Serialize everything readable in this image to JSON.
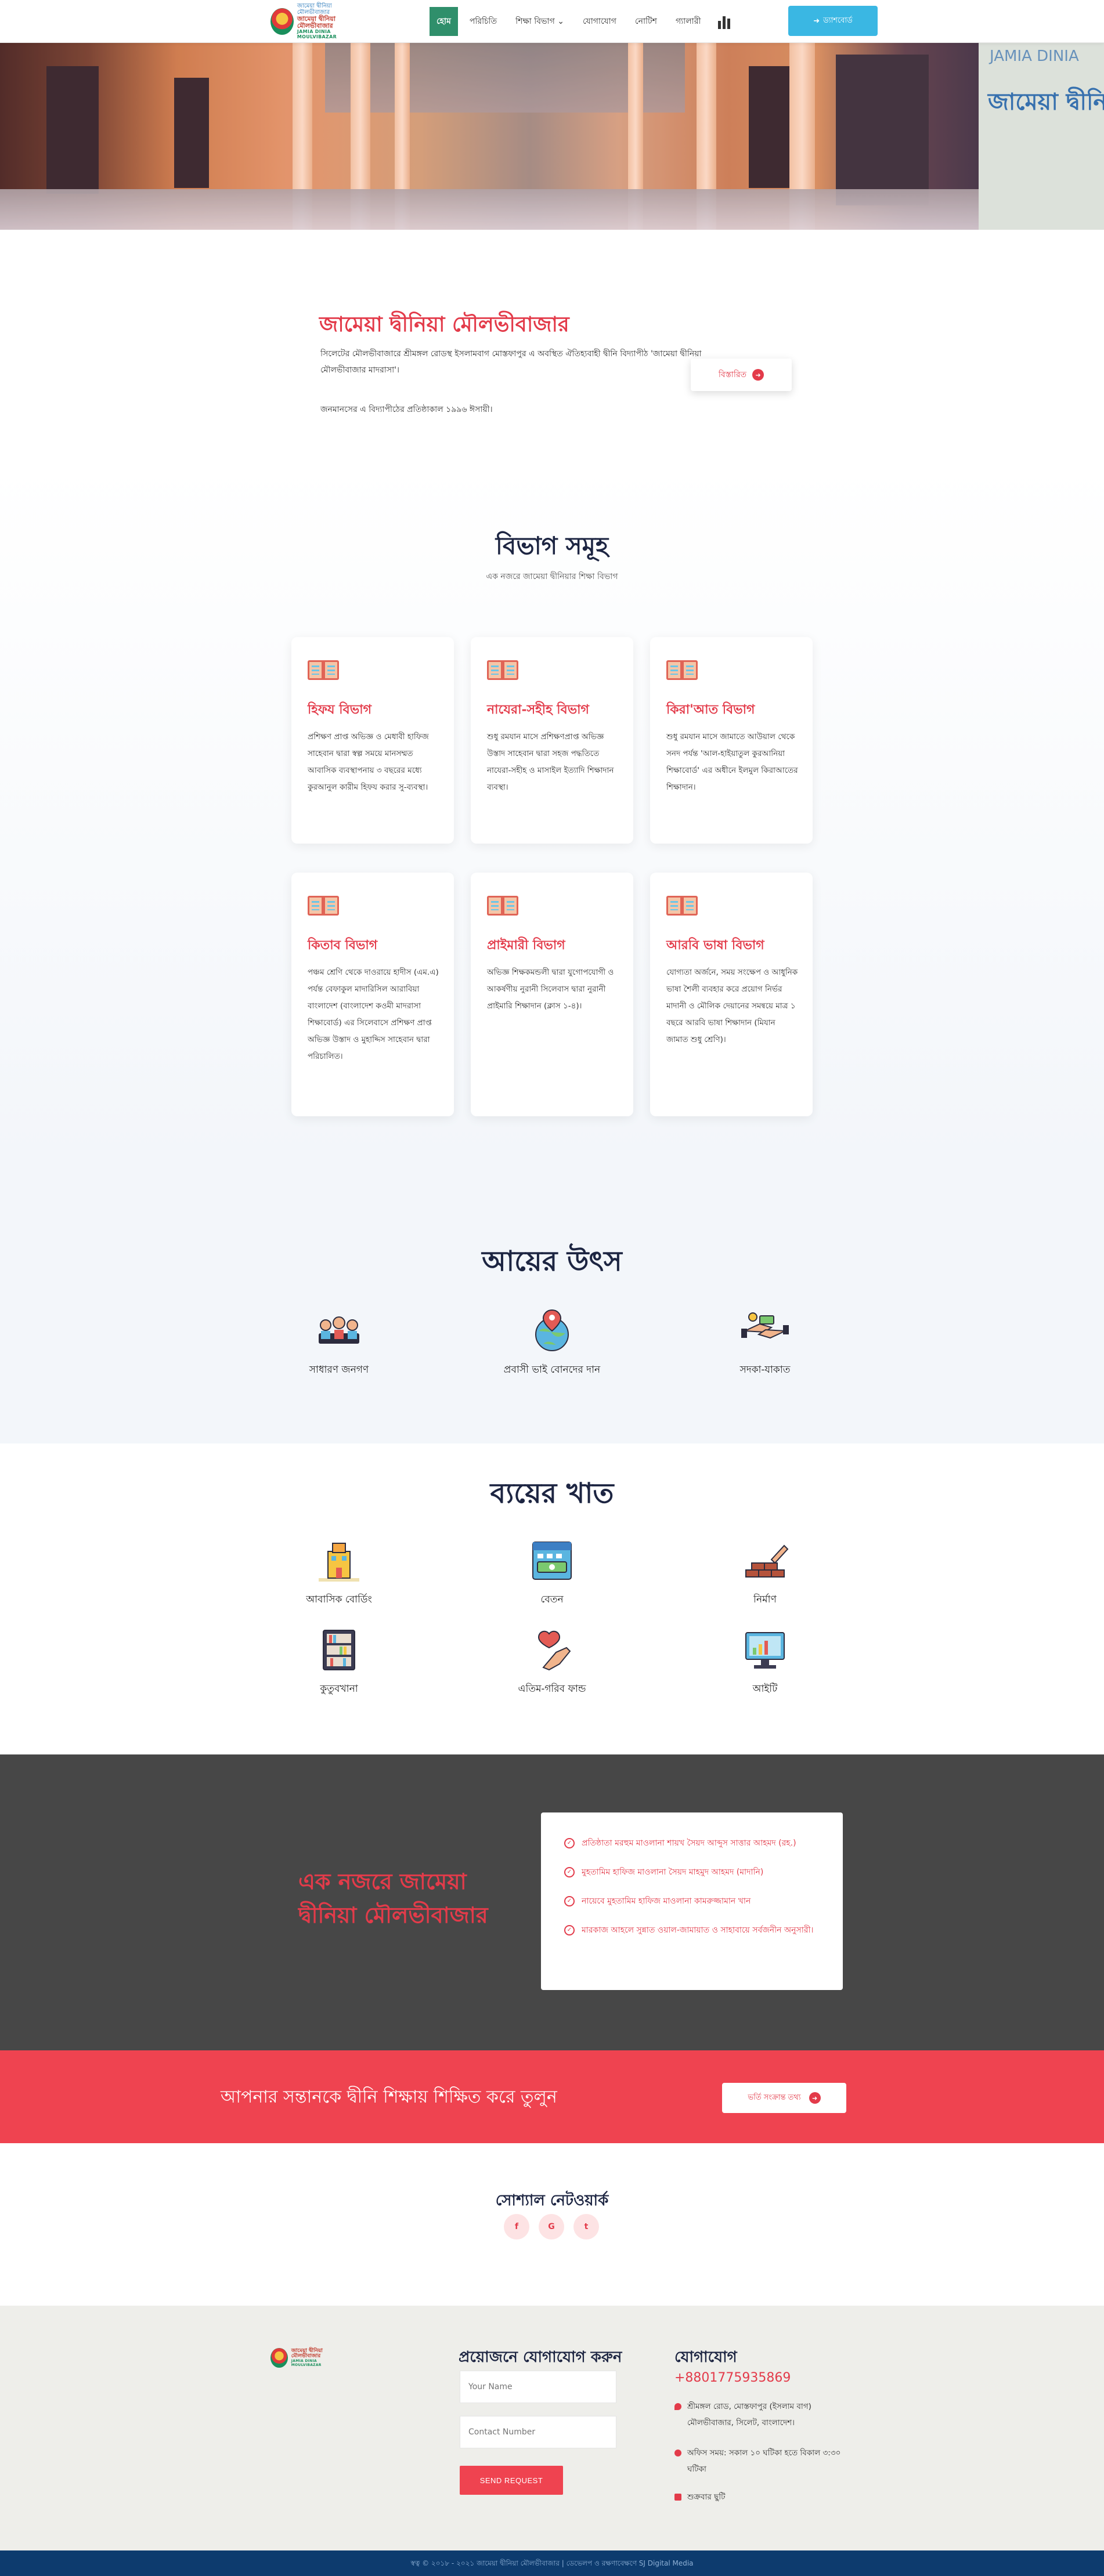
{
  "header": {
    "logo": {
      "line1": "জামেয়া দ্বীনিয়া মৌলভীবাজার",
      "line2": "জামেয়া দ্বীনিয়া মৌলভীবাজার",
      "line3": "JAMIA DINIA MOULVIBAZAR"
    },
    "nav": [
      {
        "label": "হোম",
        "active": true
      },
      {
        "label": "পরিচিতি"
      },
      {
        "label": "শিক্ষা বিভাগ ⌄"
      },
      {
        "label": "যোগাযোগ"
      },
      {
        "label": "নোটিশ"
      },
      {
        "label": "গ্যালারী"
      }
    ],
    "dashboard_label": "ড্যাশবোর্ড",
    "accent": "#2f8f6b"
  },
  "hero": {
    "sign_top": "JAMIA DINIA",
    "sign_text": "জামেয়া দ্বীনিয়া"
  },
  "intro": {
    "title": "জামেয়া দ্বীনিয়া মৌলভীবাজার",
    "text": "সিলেটের মৌলভীবাজারে শ্রীমঙ্গল রোডস্থ ইসলামবাগ মোস্তফাপুর এ অবস্থিত ঐতিহ্যবাহী দ্বীনি বিদ্যাপীঠ 'জামেয়া দ্বীনিয়া মৌলভীবাজার মাদরাসা'।",
    "text2": "জনমানসের এ বিদ্যাপীঠের প্রতিষ্ঠাকাল ১৯৯৬ ঈসায়ী।",
    "more_label": "বিস্তারিত"
  },
  "departments": {
    "title": "বিভাগ সমূহ",
    "subtitle": "এক নজরে জামেয়া দ্বীনিয়ার শিক্ষা বিভাগ",
    "cards": [
      {
        "title": "হিফয বিভাগ",
        "text": "প্রশিক্ষণ প্রাপ্ত অভিজ্ঞ ও মেধাবী হাফিজ সাহেবান দ্বারা স্বল্প সময়ে মানসম্মত আবাসিক ব্যবস্থাপনায় ৩ বছরের মধ্যে কুরআনুল কারীম হিফয করার সু-ব্যবস্থা।"
      },
      {
        "title": "নাযেরা-সহীহ বিভাগ",
        "text": "শুধু রমযান মাসে প্রশিক্ষণপ্রাপ্ত অভিজ্ঞ উস্তাদ সাহেবান দ্বারা সহজ পদ্ধতিতে নাযেরা-সহীহ ও মাসাইল ইত্যাদি শিক্ষাদান ব্যবস্থা।"
      },
      {
        "title": "কিরা'আত বিভাগ",
        "text": "শুধু রমযান মাসে জামাতে আউয়াল থেকে সনদ পর্যন্ত 'আল-হাইয়াতুল কুরআনিয়া শিক্ষাবোর্ড' এর অধীনে ইলমুল কিরাআতের শিক্ষাদান।"
      },
      {
        "title": "কিতাব বিভাগ",
        "text": "পঞ্চম শ্রেণি থেকে দাওরায়ে হাদীস (এম.এ) পর্যন্ত বেফাকুল মাদারিসিল আরাবিয়া বাংলাদেশ (বাংলাদেশ কওমী মাদরাসা শিক্ষাবোর্ড) এর সিলেবাসে প্রশিক্ষণ প্রাপ্ত অভিজ্ঞ উস্তাদ ও মুহাদ্দিস সাহেবান দ্বারা পরিচালিত।"
      },
      {
        "title": "প্রাইমারী বিভাগ",
        "text": "অভিজ্ঞ শিক্ষকমন্ডলী দ্বারা যুগোপযোগী ও আকর্ষণীয় নুরানী সিলেবাস দ্বারা নুরানী প্রাইমারি শিক্ষাদান (ক্লাস ১-৪)।"
      },
      {
        "title": "আরবি ভাষা বিভাগ",
        "text": "যোগ্যতা অর্জনে, সময় সংক্ষেপ ও আধুনিক ভাষা শৈলী ব্যবহার করে প্রয়োগ নির্ভর মাদানী ও মৌলিক দেয়ানের সমন্বয়ে মাত্র ১ বছরে আরবি ভাষা শিক্ষাদান (মিযান জামাত শুধু শ্রেণি)।"
      }
    ]
  },
  "income": {
    "title": "আয়ের উৎস",
    "items": [
      {
        "label": "সাধারণ জনগণ",
        "icon": "people-icon"
      },
      {
        "label": "প্রবাসী ভাই বোনদের দান",
        "icon": "globe-pin-icon"
      },
      {
        "label": "সদকা-যাকাত",
        "icon": "charity-hands-icon"
      }
    ]
  },
  "expense": {
    "title": "ব্যয়ের খাত",
    "items": [
      {
        "label": "আবাসিক বোর্ডিং",
        "icon": "building-icon"
      },
      {
        "label": "বেতন",
        "icon": "calendar-money-icon"
      },
      {
        "label": "নির্মাণ",
        "icon": "bricks-icon"
      },
      {
        "label": "কুতুবখানা",
        "icon": "bookshelf-icon"
      },
      {
        "label": "এতিম-গরিব ফান্ড",
        "icon": "heart-hand-icon"
      },
      {
        "label": "আইটি",
        "icon": "computer-icon"
      }
    ]
  },
  "overview": {
    "title": "এক নজরে জামেয়া দ্বীনিয়া মৌলভীবাজার",
    "items": [
      "প্রতিষ্ঠাতা মরহুম মাওলানা শায়খ সৈয়দ আব্দুস সাত্তার আহমদ (রহ.)",
      "মুহতামিম হাফিজ মাওলানা সৈয়দ মাহমুদ আহমদ (মাদানি)",
      "নায়েবে মুহতামিম হাফিজ মাওলানা কামরুজ্জামান খান",
      "মারকাজ আহলে সুন্নাত ওয়াল-জামায়াত ও সাহাবায়ে সর্বজনীন অনুসারী।"
    ]
  },
  "cta": {
    "text": "আপনার সন্তানকে দ্বীনি শিক্ষায় শিক্ষিত করে তুলুন",
    "button_label": "ভর্তি সংক্রান্ত তথ্য"
  },
  "social": {
    "title": "সোশ্যাল নেটওয়ার্ক",
    "icons": [
      {
        "glyph": "f",
        "name": "facebook-icon"
      },
      {
        "glyph": "G",
        "name": "google-icon"
      },
      {
        "glyph": "t",
        "name": "twitter-icon"
      }
    ]
  },
  "footer": {
    "form_title": "প্রয়োজনে যোগাযোগ করুন",
    "name_placeholder": "Your Name",
    "contact_placeholder": "Contact Number",
    "send_label": "SEND REQUEST",
    "contact_title": "যোগাযোগ",
    "phone": "+8801775935869",
    "address": "শ্রীমঙ্গল রোড, মোস্তফাপুর (ইসলাম বাগ) মৌলভীবাজার, সিলেট, বাংলাদেশ।",
    "hours": "অফিস সময়: সকাল ১০ ঘটিকা হতে বিকাল ৩:৩০ ঘটিকা",
    "holiday": "শুক্রবার ছুটি"
  },
  "copyright": "স্বত্ব © ২০১৮ - ২০২১ জামেয়া দ্বীনিয়া মৌলভীবাজার | ডেভেলপ ও রক্ষণাবেক্ষণে SJ Digital Media"
}
